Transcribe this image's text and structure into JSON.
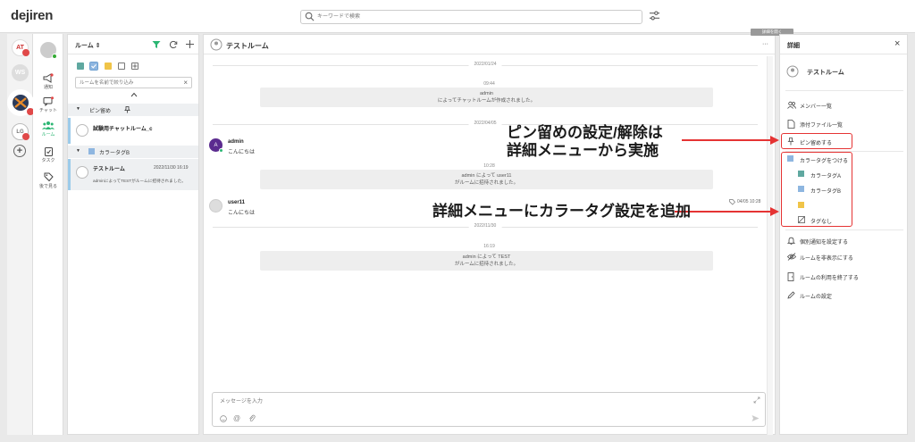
{
  "app": {
    "logo": "dejiren"
  },
  "search": {
    "placeholder": "キーワードで検索"
  },
  "rail": {
    "workspaces": [
      {
        "label": "AT",
        "badge": ""
      },
      {
        "label": "WS",
        "badge": ""
      },
      {
        "label": "",
        "badge": ""
      },
      {
        "label": "LG",
        "badge": ""
      }
    ]
  },
  "nav": {
    "items": [
      {
        "label": "通知"
      },
      {
        "label": "チャット"
      },
      {
        "label": "ルーム"
      },
      {
        "label": "タスク"
      },
      {
        "label": "後で見る"
      }
    ]
  },
  "rooms": {
    "title": "ルーム ⇕",
    "search_placeholder": "ルームを名前で絞り込み",
    "pinned_group": "ピン留め",
    "pinned_room": "試験用チャットルーム_c",
    "color_group": "カラータグB",
    "room_name": "テストルーム",
    "room_time": "2022/11/30 16:19",
    "room_preview": "adminによってTESTがルームに招待されました。",
    "colors": {
      "tagA": "#5fa8a0",
      "tagB": "#8eb6e0",
      "tagC": "#f0c448"
    }
  },
  "chat": {
    "title": "テストルーム",
    "more": "···",
    "tooltip": "詳細を開く",
    "date1": "2022/01/24",
    "time1": "09:44",
    "sys1_line1": "admin",
    "sys1_line2": "によってチャットルームが作成されました。",
    "date2": "2022/04/05",
    "msg1_name": "admin",
    "msg1_text": "こんにちは",
    "msg1_avatar": "A",
    "time2": "10:28",
    "sys2_line1": "admin によって user11",
    "sys2_line2": "がルームに招待されました。",
    "msg2_name": "user11",
    "msg2_text": "こんにちは",
    "msg2_time": "04/05 10:28",
    "date3": "2022/11/30",
    "time3": "16:19",
    "sys3_line1": "admin によって TEST",
    "sys3_line2": "がルームに招待されました。",
    "composer_placeholder": "メッセージを入力"
  },
  "detail": {
    "title": "詳細",
    "room_name": "テストルーム",
    "items": {
      "members": "メンバー一覧",
      "files": "添付ファイル一覧",
      "pin": "ピン留めする",
      "color_tag": "カラータグをつける",
      "tag_a": "カラータグA",
      "tag_b": "カラータグB",
      "tag_none": "タグなし",
      "notify": "個別通知を設定する",
      "hide": "ルームを非表示にする",
      "leave": "ルームの利用を終了する",
      "settings": "ルームの設定"
    }
  },
  "annotations": {
    "pin_line1": "ピン留めの設定/解除は",
    "pin_line2": "詳細メニューから実施",
    "color_line1": "詳細メニューにカラータグ設定を追加"
  },
  "accent": {
    "red": "#e53333",
    "green": "#2bb673"
  }
}
